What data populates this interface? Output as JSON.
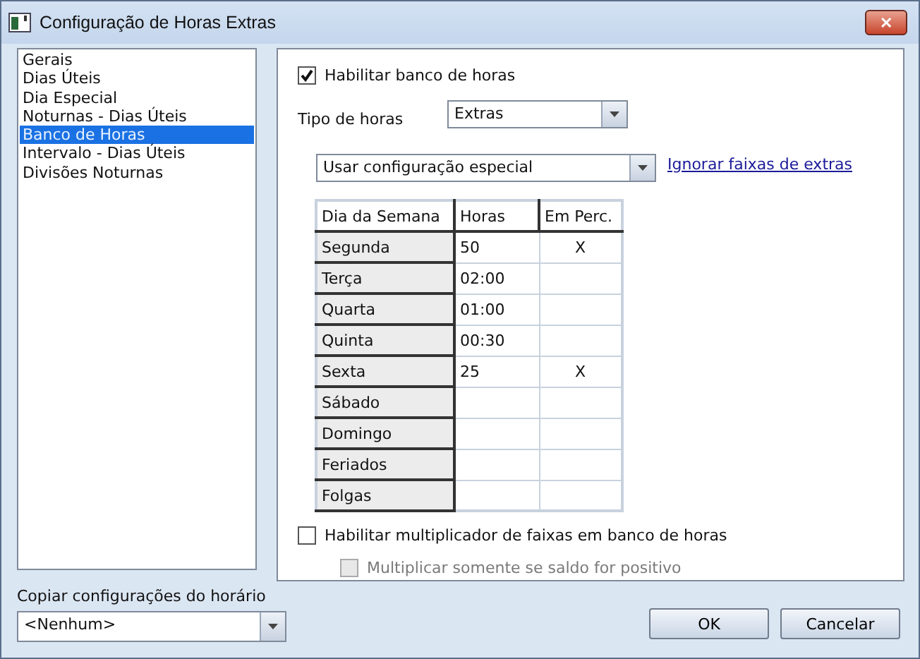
{
  "window": {
    "title": "Configuração de Horas Extras",
    "close": "✕"
  },
  "sidebar": {
    "items": [
      {
        "label": "Gerais",
        "selected": false
      },
      {
        "label": "Dias Úteis",
        "selected": false
      },
      {
        "label": "Dia Especial",
        "selected": false
      },
      {
        "label": "Noturnas - Dias Úteis",
        "selected": false
      },
      {
        "label": "Banco de Horas",
        "selected": true
      },
      {
        "label": "Intervalo - Dias Úteis",
        "selected": false
      },
      {
        "label": "Divisões Noturnas",
        "selected": false
      }
    ]
  },
  "enable_bank": {
    "label": "Habilitar banco de horas",
    "checked": true,
    "disabled": false
  },
  "hour_type": {
    "label": "Tipo de horas",
    "value": "Extras"
  },
  "config_mode": {
    "value": "Usar configuração especial"
  },
  "ignore_link": "Ignorar faixas de extras",
  "table": {
    "columns": [
      "Dia da Semana",
      "Horas",
      "Em Perc."
    ],
    "rows": [
      [
        "Segunda",
        "50",
        "X"
      ],
      [
        "Terça",
        "02:00",
        ""
      ],
      [
        "Quarta",
        "01:00",
        ""
      ],
      [
        "Quinta",
        "00:30",
        ""
      ],
      [
        "Sexta",
        "25",
        "X"
      ],
      [
        "Sábado",
        "",
        ""
      ],
      [
        "Domingo",
        "",
        ""
      ],
      [
        "Feriados",
        "",
        ""
      ],
      [
        "Folgas",
        "",
        ""
      ]
    ]
  },
  "options": [
    {
      "label": "Habilitar multiplicador de faixas em banco de horas",
      "checked": false,
      "disabled": false,
      "indented": false
    },
    {
      "label": "Multiplicar somente se saldo for positivo",
      "checked": false,
      "disabled": true,
      "indented": true
    }
  ],
  "copy": {
    "label": "Copiar configurações do horário",
    "value": "<Nenhum>"
  },
  "buttons": [
    "OK",
    "Cancelar"
  ]
}
